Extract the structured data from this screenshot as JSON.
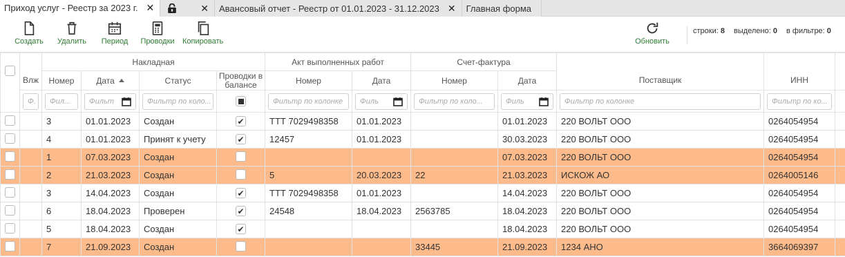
{
  "tabs": [
    {
      "label": "Приход услуг - Реестр за 2023 г.",
      "active": true,
      "icon": null
    },
    {
      "label": "",
      "active": false,
      "icon": "lock-icon"
    },
    {
      "label": "Авансовый отчет - Реестр от 01.01.2023 - 31.12.2023",
      "active": false,
      "icon": null
    },
    {
      "label": "Главная форма",
      "active": false,
      "icon": null
    }
  ],
  "toolbar": {
    "create": "Создать",
    "delete": "Удалить",
    "period": "Период",
    "postings": "Проводки",
    "copy": "Копировать",
    "refresh": "Обновить"
  },
  "stats": {
    "rows_label": "строки:",
    "rows": "8",
    "selected_label": "выделено:",
    "selected": "0",
    "filter_label": "в фильтре:",
    "filter": "0"
  },
  "groups": {
    "invoice": "Накладная",
    "act": "Акт выполненных работ",
    "sf": "Счет-фактура"
  },
  "columns": {
    "attach": "Влж",
    "number": "Номер",
    "date": "Дата",
    "status": "Статус",
    "in_balance": "Проводки в балансе",
    "act_number": "Номер",
    "act_date": "Дата",
    "sf_number": "Номер",
    "sf_date": "Дата",
    "supplier": "Поставщик",
    "inn": "ИНН"
  },
  "filters": {
    "attach": "Ф.",
    "number": "Фил...",
    "date": "Фильт",
    "status": "Фильтр по коло...",
    "act_number": "Фильтр по колонке",
    "act_date": "Филь",
    "sf_number": "Фильтр по коло...",
    "sf_date": "Филь",
    "supplier": "Фильтр по колонке",
    "inn": "Фильтр по ко..."
  },
  "colors": {
    "highlight": "#fdbb8b",
    "accent_green": "#2e7d32"
  },
  "rows": [
    {
      "number": "3",
      "date": "01.01.2023",
      "status": "Создан",
      "in_balance": true,
      "act_number": "ТТТ 7029498358",
      "act_date": "01.01.2023",
      "sf_number": "",
      "sf_date": "01.01.2023",
      "supplier": "220 ВОЛЬТ ООО",
      "inn": "0264054954",
      "highlight": false
    },
    {
      "number": "4",
      "date": "01.01.2023",
      "status": "Принят к учету",
      "in_balance": true,
      "act_number": "12457",
      "act_date": "01.01.2023",
      "sf_number": "",
      "sf_date": "30.03.2023",
      "supplier": "220 ВОЛЬТ ООО",
      "inn": "0264054954",
      "highlight": false
    },
    {
      "number": "1",
      "date": "07.03.2023",
      "status": "Создан",
      "in_balance": false,
      "act_number": "",
      "act_date": "",
      "sf_number": "",
      "sf_date": "07.03.2023",
      "supplier": "220 ВОЛЬТ ООО",
      "inn": "0264054954",
      "highlight": true
    },
    {
      "number": "2",
      "date": "21.03.2023",
      "status": "Создан",
      "in_balance": false,
      "act_number": "5",
      "act_date": "20.03.2023",
      "sf_number": "22",
      "sf_date": "21.03.2023",
      "supplier": "ИСКОЖ АО",
      "inn": "0264005146",
      "highlight": true
    },
    {
      "number": "3",
      "date": "14.04.2023",
      "status": "Создан",
      "in_balance": true,
      "act_number": "ТТТ 7029498358",
      "act_date": "01.01.2023",
      "sf_number": "",
      "sf_date": "14.04.2023",
      "supplier": "220 ВОЛЬТ ООО",
      "inn": "0264054954",
      "highlight": false
    },
    {
      "number": "6",
      "date": "18.04.2023",
      "status": "Проверен",
      "in_balance": true,
      "act_number": "24548",
      "act_date": "18.04.2023",
      "sf_number": "2563785",
      "sf_date": "18.04.2023",
      "supplier": "220 ВОЛЬТ ООО",
      "inn": "0264054954",
      "highlight": false
    },
    {
      "number": "5",
      "date": "18.04.2023",
      "status": "Создан",
      "in_balance": true,
      "act_number": "",
      "act_date": "",
      "sf_number": "",
      "sf_date": "18.04.2023",
      "supplier": "220 ВОЛЬТ ООО",
      "inn": "0264054954",
      "highlight": false
    },
    {
      "number": "7",
      "date": "21.09.2023",
      "status": "Создан",
      "in_balance": false,
      "act_number": "",
      "act_date": "",
      "sf_number": "33445",
      "sf_date": "21.09.2023",
      "supplier": "1234 АНО",
      "inn": "3664069397",
      "highlight": true
    }
  ]
}
